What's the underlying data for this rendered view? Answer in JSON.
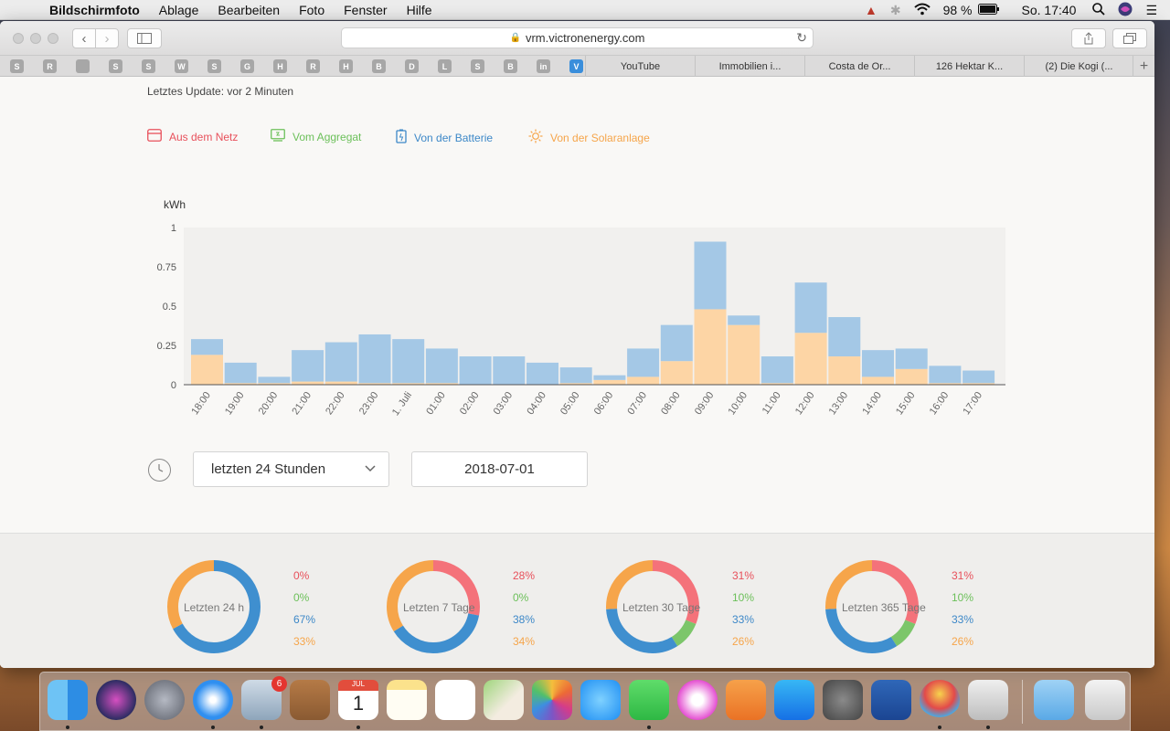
{
  "menubar": {
    "app": "Bildschirmfoto",
    "items": [
      "Ablage",
      "Bearbeiten",
      "Foto",
      "Fenster",
      "Hilfe"
    ],
    "battery": "98 %",
    "clock": "So. 17:40"
  },
  "browser": {
    "url": "vrm.victronenergy.com",
    "favicons": [
      "S",
      "R",
      "",
      "S",
      "S",
      "W",
      "S",
      "G",
      "H",
      "R",
      "H",
      "B",
      "D",
      "L",
      "S",
      "B",
      "in",
      "V"
    ],
    "tabs": [
      "YouTube",
      "Immobilien i...",
      "Costa de Or...",
      "126 Hektar K...",
      "(2) Die Kogi (..."
    ]
  },
  "page": {
    "last_update": "Letztes Update: vor 2 Minuten",
    "legend": [
      {
        "label": "Aus dem Netz",
        "color": "#e8505b",
        "icon": "grid-icon"
      },
      {
        "label": "Vom Aggregat",
        "color": "#6cc05a",
        "icon": "generator-icon"
      },
      {
        "label": "Von der Batterie",
        "color": "#3d88c8",
        "icon": "battery-icon"
      },
      {
        "label": "Von der Solaranlage",
        "color": "#f6a54a",
        "icon": "sun-icon"
      }
    ],
    "range_select": "letzten 24 Stunden",
    "date": "2018-07-01"
  },
  "chart_data": {
    "type": "bar",
    "ylabel": "kWh",
    "ylim": [
      0,
      1
    ],
    "yticks": [
      "0",
      "0.25",
      "0.5",
      "0.75",
      "1"
    ],
    "categories": [
      "18:00",
      "19:00",
      "20:00",
      "21:00",
      "22:00",
      "23:00",
      "1. Juli",
      "01:00",
      "02:00",
      "03:00",
      "04:00",
      "05:00",
      "06:00",
      "07:00",
      "08:00",
      "09:00",
      "10:00",
      "11:00",
      "12:00",
      "13:00",
      "14:00",
      "15:00",
      "16:00",
      "17:00"
    ],
    "series": [
      {
        "color": "#fdd5a5",
        "values": [
          0.19,
          0.01,
          0.01,
          0.02,
          0.02,
          0.01,
          0.01,
          0.01,
          0,
          0,
          0,
          0.01,
          0.03,
          0.05,
          0.15,
          0.48,
          0.38,
          0.01,
          0.33,
          0.18,
          0.05,
          0.1,
          0.01,
          0.01
        ]
      },
      {
        "color": "#a4c8e6",
        "values": [
          0.1,
          0.13,
          0.04,
          0.2,
          0.25,
          0.31,
          0.28,
          0.22,
          0.18,
          0.18,
          0.14,
          0.1,
          0.03,
          0.18,
          0.23,
          0.43,
          0.06,
          0.17,
          0.32,
          0.25,
          0.17,
          0.13,
          0.11,
          0.08
        ]
      }
    ]
  },
  "summary": [
    {
      "label": "Letzten 24 h",
      "pcts": [
        "0%",
        "0%",
        "67%",
        "33%"
      ],
      "values": [
        0,
        0,
        67,
        33
      ]
    },
    {
      "label": "Letzten 7 Tage",
      "pcts": [
        "28%",
        "0%",
        "38%",
        "34%"
      ],
      "values": [
        28,
        0,
        38,
        34
      ]
    },
    {
      "label": "Letzten 30 Tage",
      "pcts": [
        "31%",
        "10%",
        "33%",
        "26%"
      ],
      "values": [
        31,
        10,
        33,
        26
      ]
    },
    {
      "label": "Letzten 365 Tage",
      "pcts": [
        "31%",
        "10%",
        "33%",
        "26%"
      ],
      "values": [
        31,
        10,
        33,
        26
      ]
    }
  ],
  "colors": {
    "grid": "#f4727a",
    "generator": "#7cc66a",
    "battery": "#3f8fcf",
    "solar": "#f6a54a"
  },
  "dock": {
    "apps": [
      "finder-icon",
      "siri-icon",
      "launchpad-icon",
      "safari-icon",
      "mail-icon",
      "contacts-icon",
      "calendar-icon",
      "notes-icon",
      "reminders-icon",
      "maps-icon",
      "photos-icon",
      "messages-icon",
      "facetime-icon",
      "itunes-icon",
      "ibooks-icon",
      "appstore-icon",
      "system-preferences-icon",
      "victron-icon",
      "balloon-icon",
      "screenshot-icon",
      "folder-icon",
      "trash-icon"
    ],
    "mail_badge": "6",
    "calendar_month": "JUL",
    "calendar_day": "1"
  }
}
